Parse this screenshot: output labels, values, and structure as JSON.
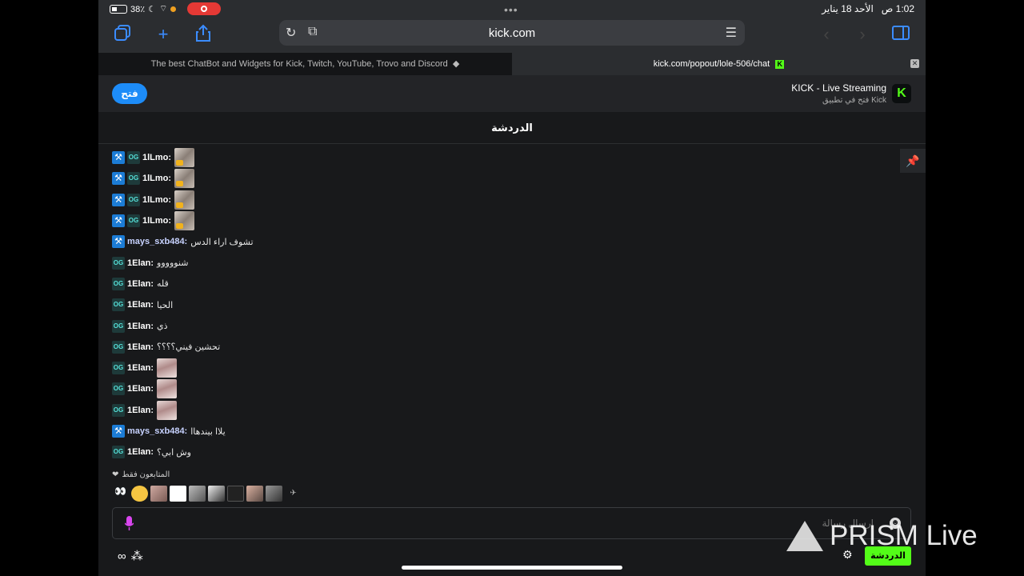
{
  "status_bar": {
    "time": "1:02 ص",
    "date": "الأحد 18 يناير",
    "battery": "38٪"
  },
  "browser": {
    "url": "kick.com",
    "tabs": [
      {
        "label": "The best ChatBot and Widgets for Kick, Twitch, YouTube, Trovo and Discord"
      },
      {
        "label": "kick.com/popout/lole-506/chat"
      }
    ]
  },
  "banner": {
    "open_label": "فتح",
    "title": "KICK - Live Streaming",
    "subtitle": "فتح في تطبيق Kick"
  },
  "chat": {
    "title": "الدردشة",
    "messages": [
      {
        "user": "1lLmo:",
        "text": "",
        "emote": "emote-a",
        "badges": [
          "mod",
          "og"
        ],
        "color": "#ffffff"
      },
      {
        "user": "1lLmo:",
        "text": "",
        "emote": "emote-a",
        "badges": [
          "mod",
          "og"
        ],
        "color": "#ffffff"
      },
      {
        "user": "1lLmo:",
        "text": "",
        "emote": "emote-a",
        "badges": [
          "mod",
          "og"
        ],
        "color": "#ffffff"
      },
      {
        "user": "1lLmo:",
        "text": "",
        "emote": "emote-a",
        "badges": [
          "mod",
          "og"
        ],
        "color": "#ffffff"
      },
      {
        "user": "mays_sxb484:",
        "text": "تشوف اراء الدس",
        "emote": "",
        "badges": [
          "mod"
        ],
        "color": "#c7d2ff"
      },
      {
        "user": "1Elan:",
        "text": "شنووووو",
        "emote": "",
        "badges": [
          "og"
        ],
        "color": "#ffffff"
      },
      {
        "user": "1Elan:",
        "text": "قله",
        "emote": "",
        "badges": [
          "og"
        ],
        "color": "#ffffff"
      },
      {
        "user": "1Elan:",
        "text": "الحيا",
        "emote": "",
        "badges": [
          "og"
        ],
        "color": "#ffffff"
      },
      {
        "user": "1Elan:",
        "text": "ذي",
        "emote": "",
        "badges": [
          "og"
        ],
        "color": "#ffffff"
      },
      {
        "user": "1Elan:",
        "text": "تحشين فيني؟؟؟؟",
        "emote": "",
        "badges": [
          "og"
        ],
        "color": "#ffffff"
      },
      {
        "user": "1Elan:",
        "text": "",
        "emote": "emote-b",
        "badges": [
          "og"
        ],
        "color": "#ffffff"
      },
      {
        "user": "1Elan:",
        "text": "",
        "emote": "emote-b",
        "badges": [
          "og"
        ],
        "color": "#ffffff"
      },
      {
        "user": "1Elan:",
        "text": "",
        "emote": "emote-b",
        "badges": [
          "og"
        ],
        "color": "#ffffff"
      },
      {
        "user": "mays_sxb484:",
        "text": "يلاا بيندهاا",
        "emote": "",
        "badges": [
          "mod"
        ],
        "color": "#c7d2ff"
      },
      {
        "user": "1Elan:",
        "text": "وش ابي؟",
        "emote": "",
        "badges": [
          "og"
        ],
        "color": "#ffffff"
      }
    ],
    "followers_only": "المتابعون فقط",
    "input_placeholder": "إرسال رسالة",
    "send_label": "الدردشة"
  },
  "watermark": "PRISM Live",
  "colors": {
    "kick_green": "#53fc18",
    "mod_blue": "#1c7cd5",
    "ios_blue": "#3b8cff"
  }
}
